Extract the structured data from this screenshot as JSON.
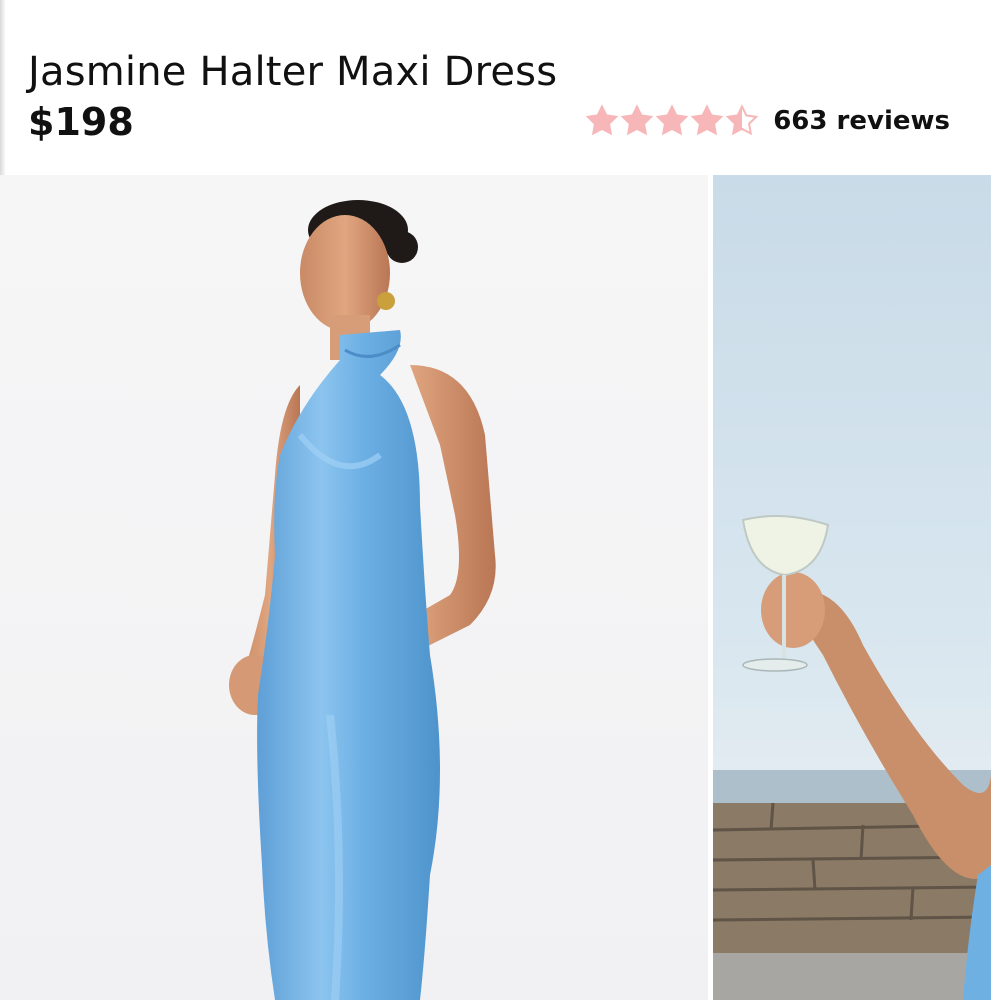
{
  "product": {
    "title": "Jasmine Halter Maxi Dress",
    "price": "$198",
    "rating": 4.5,
    "max_rating": 5,
    "review_count_label": "663 reviews"
  },
  "colors": {
    "star_fill": "#f7b6b8",
    "star_empty": "#f7b6b8",
    "dress": "#7db6e4",
    "text": "#111111"
  },
  "gallery": {
    "images": [
      {
        "name": "model-front",
        "icon": "product-photo"
      },
      {
        "name": "model-holding-glass",
        "icon": "product-photo"
      }
    ]
  }
}
